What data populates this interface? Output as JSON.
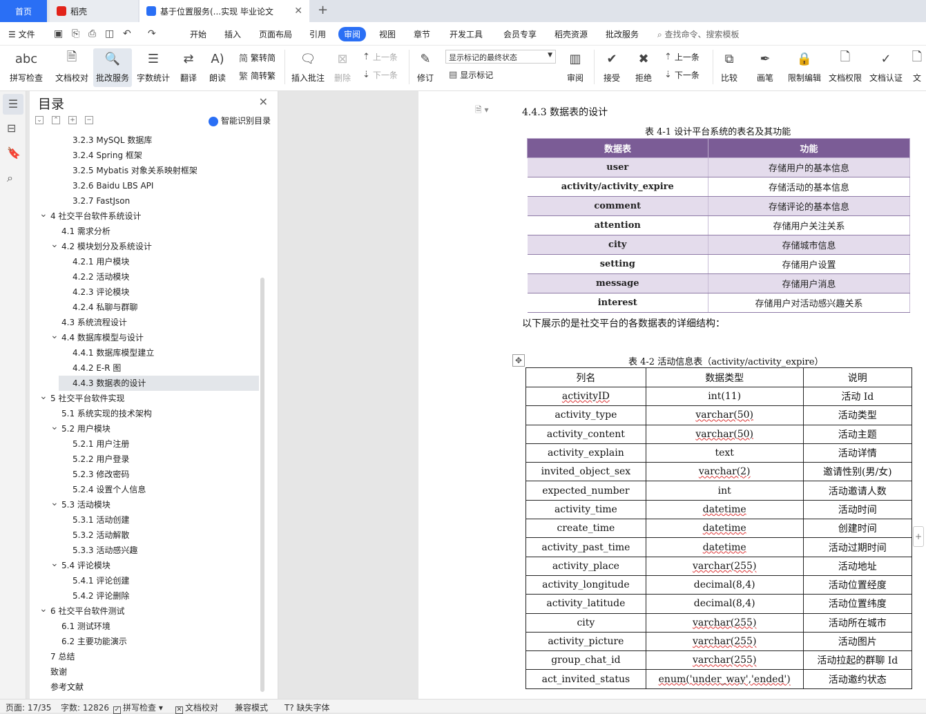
{
  "tabs": {
    "home": "首页",
    "daoke": "稻壳",
    "doc": "基于位置服务(...实现 毕业论文"
  },
  "menu": {
    "file": "文件",
    "items": [
      "开始",
      "插入",
      "页面布局",
      "引用",
      "审阅",
      "视图",
      "章节",
      "开发工具",
      "会员专享",
      "稻壳资源",
      "批改服务"
    ],
    "active": "审阅",
    "search": "查找命令、搜索模板"
  },
  "ribbon": {
    "spellcheck": "拼写检查",
    "doccheck": "文档校对",
    "revise_service": "批改服务",
    "wordcount": "字数统计",
    "translate": "翻译",
    "read": "朗读",
    "trad": "繁转简",
    "simp": "简转繁",
    "insert_comment": "插入批注",
    "delete": "删除",
    "prev": "上一条",
    "next": "下一条",
    "track": "修订",
    "markup_state": "显示标记的最终状态",
    "show_markup": "显示标记",
    "review": "审阅",
    "accept": "接受",
    "reject": "拒绝",
    "prev2": "上一条",
    "next2": "下一条",
    "compare": "比较",
    "pen": "画笔",
    "restrict": "限制编辑",
    "doc_rights": "文档权限",
    "doc_auth": "文档认证",
    "doc_more": "文"
  },
  "toc": {
    "title": "目录",
    "smart": "智能识别目录",
    "items": [
      {
        "label": "3.2.3 MySQL 数据库",
        "level": 3
      },
      {
        "label": "3.2.4 Spring 框架",
        "level": 3
      },
      {
        "label": "3.2.5 Mybatis 对象关系映射框架",
        "level": 3
      },
      {
        "label": "3.2.6 Baidu LBS API",
        "level": 3
      },
      {
        "label": "3.2.7 FastJson",
        "level": 3
      },
      {
        "label": "4 社交平台软件系统设计",
        "level": 1,
        "expanded": true
      },
      {
        "label": "4.1 需求分析",
        "level": 2
      },
      {
        "label": "4.2 模块划分及系统设计",
        "level": 2,
        "expanded": true
      },
      {
        "label": "4.2.1 用户模块",
        "level": 3
      },
      {
        "label": "4.2.2 活动模块",
        "level": 3
      },
      {
        "label": "4.2.3 评论模块",
        "level": 3
      },
      {
        "label": "4.2.4 私聊与群聊",
        "level": 3
      },
      {
        "label": "4.3 系统流程设计",
        "level": 2
      },
      {
        "label": "4.4 数据库模型与设计",
        "level": 2,
        "expanded": true
      },
      {
        "label": "4.4.1 数据库模型建立",
        "level": 3
      },
      {
        "label": "4.4.2 E-R 图",
        "level": 3
      },
      {
        "label": "4.4.3 数据表的设计",
        "level": 3,
        "selected": true
      },
      {
        "label": "5 社交平台软件实现",
        "level": 1,
        "expanded": true
      },
      {
        "label": "5.1 系统实现的技术架构",
        "level": 2
      },
      {
        "label": "5.2 用户模块",
        "level": 2,
        "expanded": true
      },
      {
        "label": "5.2.1 用户注册",
        "level": 3
      },
      {
        "label": "5.2.2 用户登录",
        "level": 3
      },
      {
        "label": "5.2.3 修改密码",
        "level": 3
      },
      {
        "label": "5.2.4 设置个人信息",
        "level": 3
      },
      {
        "label": "5.3 活动模块",
        "level": 2,
        "expanded": true
      },
      {
        "label": "5.3.1 活动创建",
        "level": 3
      },
      {
        "label": "5.3.2 活动解散",
        "level": 3
      },
      {
        "label": "5.3.3 活动感兴趣",
        "level": 3
      },
      {
        "label": "5.4 评论模块",
        "level": 2,
        "expanded": true
      },
      {
        "label": "5.4.1 评论创建",
        "level": 3
      },
      {
        "label": "5.4.2 评论删除",
        "level": 3
      },
      {
        "label": "6 社交平台软件测试",
        "level": 1,
        "expanded": true
      },
      {
        "label": "6.1 测试环境",
        "level": 2
      },
      {
        "label": "6.2 主要功能演示",
        "level": 2
      },
      {
        "label": "7 总结",
        "level": 1
      },
      {
        "label": "致谢",
        "level": 1
      },
      {
        "label": "参考文献",
        "level": 1
      }
    ]
  },
  "doc": {
    "heading": "4.4.3  数据表的设计",
    "table1_caption": "表 4-1 设计平台系统的表名及其功能",
    "table1_headers": [
      "数据表",
      "功能"
    ],
    "table1_rows": [
      [
        "user",
        "存储用户的基本信息"
      ],
      [
        "activity/activity_expire",
        "存储活动的基本信息"
      ],
      [
        "comment",
        "存储评论的基本信息"
      ],
      [
        "attention",
        "存储用户关注关系"
      ],
      [
        "city",
        "存储城市信息"
      ],
      [
        "setting",
        "存储用户设置"
      ],
      [
        "message",
        "存储用户消息"
      ],
      [
        "interest",
        "存储用户对活动感兴趣关系"
      ]
    ],
    "paragraph": "以下展示的是社交平台的各数据表的详细结构：",
    "table2_caption": "表 4-2 活动信息表（activity/activity_expire）",
    "table2_headers": [
      "列名",
      "数据类型",
      "说明"
    ],
    "table2_rows": [
      [
        "activityID",
        "int(11)",
        "活动 Id"
      ],
      [
        "activity_type",
        "varchar(50)",
        "活动类型"
      ],
      [
        "activity_content",
        "varchar(50)",
        "活动主题"
      ],
      [
        "activity_explain",
        "text",
        "活动详情"
      ],
      [
        "invited_object_sex",
        "varchar(2)",
        "邀请性别(男/女)"
      ],
      [
        "expected_number",
        "int",
        "活动邀请人数"
      ],
      [
        "activity_time",
        "datetime",
        "活动时间"
      ],
      [
        "create_time",
        "datetime",
        "创建时间"
      ],
      [
        "activity_past_time",
        "datetime",
        "活动过期时间"
      ],
      [
        "activity_place",
        "varchar(255)",
        "活动地址"
      ],
      [
        "activity_longitude",
        "decimal(8,4)",
        "活动位置经度"
      ],
      [
        "activity_latitude",
        "decimal(8,4)",
        "活动位置纬度"
      ],
      [
        "city",
        "varchar(255)",
        "活动所在城市"
      ],
      [
        "activity_picture",
        "varchar(255)",
        "活动图片"
      ],
      [
        "group_chat_id",
        "varchar(255)",
        "活动拉起的群聊 Id"
      ],
      [
        "act_invited_status",
        "enum('under_way','ended')",
        "活动邀约状态"
      ]
    ]
  },
  "status": {
    "page": "页面: 17/35",
    "words": "字数: 12826",
    "spell": "拼写检查",
    "proof": "文档校对",
    "compat": "兼容模式",
    "missing_font": "缺失字体"
  },
  "colors": {
    "accent": "#2a6ff5",
    "table_header": "#7b5c96",
    "table_stripe": "#e4dcec"
  }
}
